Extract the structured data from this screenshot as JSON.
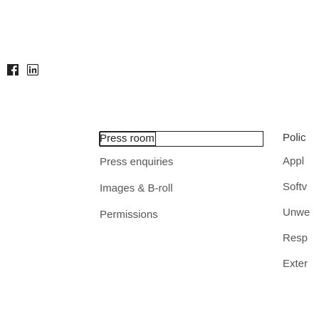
{
  "social": [
    {
      "name": "facebook",
      "icon": "facebook-icon"
    },
    {
      "name": "linkedin",
      "icon": "linkedin-icon"
    }
  ],
  "press": {
    "title": "Press room",
    "items": [
      "Press enquiries",
      "Images & B-roll",
      "Permissions"
    ]
  },
  "policies": {
    "title": "Polic",
    "items": [
      "Appl",
      "Softv",
      "Unwe",
      "Resp",
      "Exter"
    ]
  },
  "colors": {
    "text_primary": "#222222",
    "text_link": "#555555",
    "icon": "#222222"
  }
}
